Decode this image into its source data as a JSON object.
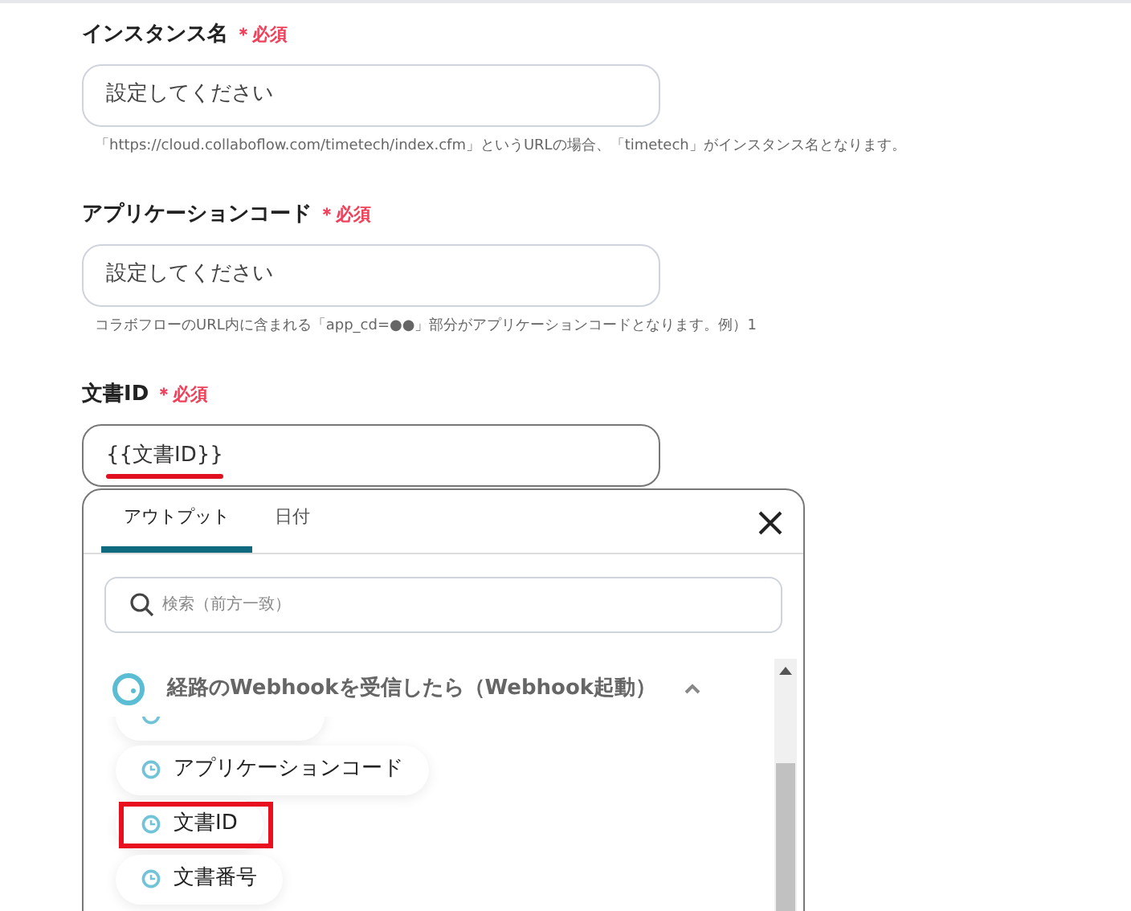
{
  "fields": [
    {
      "label": "インスタンス名",
      "required_mark": "＊必須",
      "placeholder": "設定してください",
      "hint": "「https://cloud.collaboflow.com/timetech/index.cfm」というURLの場合、「timetech」がインスタンス名となります。"
    },
    {
      "label": "アプリケーションコード",
      "required_mark": "＊必須",
      "placeholder": "設定してください",
      "hint": "コラボフローのURL内に含まれる「app_cd=●●」部分がアプリケーションコードとなります。例）1"
    },
    {
      "label": "文書ID",
      "required_mark": "＊必須",
      "value": "{{文書ID}}",
      "highlighted": true
    }
  ],
  "dropdown": {
    "tabs": [
      {
        "label": "アウトプット",
        "selected": true
      },
      {
        "label": "日付",
        "selected": false
      }
    ],
    "search": {
      "placeholder": "検索（前方一致）"
    },
    "group": {
      "title": "経路のWebhookを受信したら（Webhook起動）",
      "expanded": true,
      "items": [
        {
          "kind": "cut",
          "highlighted": false
        },
        {
          "kind": "entry",
          "label": "アプリケーションコード",
          "highlighted": false
        },
        {
          "kind": "entry",
          "label": "文書ID",
          "highlighted": true
        },
        {
          "kind": "entry",
          "label": "文書番号",
          "highlighted": false
        }
      ]
    }
  }
}
